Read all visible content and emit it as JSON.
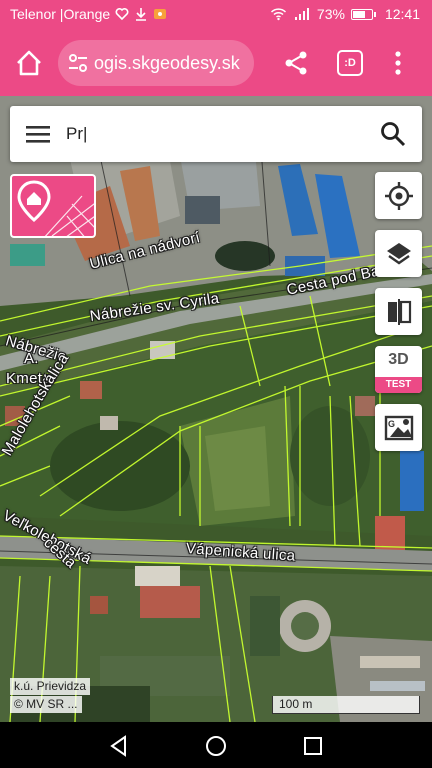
{
  "status_bar": {
    "carrier": "Telenor |Orange",
    "battery_percent": "73%",
    "battery_level": 0.73,
    "time": "12:41",
    "icons": [
      "heart-icon",
      "download-icon",
      "notification-icon",
      "wifi-icon",
      "signal-icon",
      "battery-icon"
    ]
  },
  "browser": {
    "url": "ogis.skgeodesy.sk",
    "tabs_label": ":D",
    "icons": [
      "home-icon",
      "site-settings-icon",
      "share-icon",
      "tabs-icon",
      "more-vert-icon"
    ]
  },
  "search": {
    "value": "Pr|",
    "icons": [
      "menu-icon",
      "search-icon"
    ]
  },
  "map_controls": {
    "three_d_label": "3D",
    "test_badge": "TEST",
    "icons": [
      "locate-icon",
      "layers-icon",
      "compare-icon",
      "google-maps-icon"
    ]
  },
  "street_labels": {
    "ulica_na_nadvori": "Ulica na nádvorí",
    "cesta_pod_banskou": "Cesta pod Banskou",
    "nabrezie_cyrila": "Nábrežie sv. Cyrila",
    "nabrezie": "Nábrežie",
    "a": "A.",
    "kmeta": "Kmeta",
    "ulica": "ulica",
    "malolehotska": "Malolehotská",
    "velkolehotska": "Veľkolehotská",
    "cesta": "cesta",
    "vapenicka": "Vápenická ulica"
  },
  "footer": {
    "cadastral_area": "k.ú. Prievidza",
    "copyright": "© MV SR ...",
    "scale": "100 m"
  },
  "colors": {
    "accent": "#ec4a86",
    "parcel_lines": "#c8ff2e"
  }
}
